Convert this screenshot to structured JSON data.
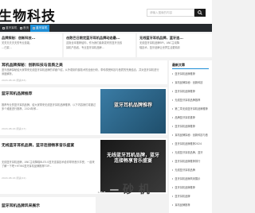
{
  "site": {
    "logo": "生物科技",
    "search_placeholder": "请输入搜索的内容"
  },
  "nav": {
    "items": [
      {
        "label": "蓝牙耳机"
      },
      {
        "label": "首页"
      },
      {
        "label": "蓝牙耳机"
      }
    ]
  },
  "top_cards": [
    {
      "title": "品牌探秘：创新科技...",
      "text1": "关关夫夫夫夫的专业技能，",
      "text2": "…已渠…"
    },
    {
      "title": "击败巴日限定蓝牙耳机品牌动态最...",
      "text1": "这篇全本推荐给你，作为我们最新发布的蓝牙无线",
      "text2": "耳机产品线，专业蓝牙耳机品牌..."
    },
    {
      "title": "无线蓝牙耳机品牌，蓝牙连...",
      "text1": "无线蓝牙耳机品牌BPI，ANC主动降",
      "text2": "噪技术，蓝牙品牌让世界生活更精彩"
    }
  ],
  "articles": [
    {
      "title": "耳机品牌探秘：创新科技与音质之美",
      "text": "蓝牙品牌探秘给大家带来无线蓝牙耳机品牌的详细介绍，从外观到内部技术的全面分析，带你感受科技与音质的完美结合，并对蓝牙耳机进行深度解析。",
      "meta": "2024-08-16 阅读(63)"
    },
    {
      "title": "蓝牙耳机品牌推荐",
      "text": "推荐专业的蓝牙耳机品牌，给大家带来无线蓝牙耳机品牌推荐，以下内容我们将通过多个维度进行推荐，2024年即...",
      "meta": "2024-08-16 阅读(17)",
      "thumb_text": "蓝牙耳机品牌推荐"
    },
    {
      "title": "无线蓝牙耳机品牌，蓝牙连接畅享音乐盛宴",
      "text": "无线蓝牙耳机品牌，ANC主动降噪BLE5.0蓝牙连接技术给你带来音乐享受，一起来了解一下吧+HTWS蓝牙耳机品牌推荐TOP...",
      "meta": "2024-08-16 阅读(22)",
      "thumb_text": "无线蓝牙耳机品牌，蓝牙连接畅享音乐盛宴"
    },
    {
      "title": "蓝牙耳机品牌风采展示",
      "text": "",
      "meta": ""
    }
  ],
  "sidebar": {
    "heading": "最新文章",
    "items": [
      "蓝牙耳机品牌推荐",
      "耳机品牌探秘：创新科技",
      "蓝牙耳机品牌推荐",
      "无线蓝牙耳机品牌推荐",
      "第二章无线蓝牙耳机品牌推荐",
      "品牌蓝牙耳机推荐",
      "蓝牙耳机品牌推荐",
      "耳机品牌探秘：创新科技与音",
      "蓝牙耳机品牌推荐2024",
      "无线蓝牙耳机品牌，蓝牙",
      "蓝牙耳机品牌推荐排行",
      "无线蓝牙耳机品牌",
      "蓝牙耳机品牌风采展示",
      "蓝牙耳机品牌推荐",
      "蓝牙耳机品牌",
      "耳机品牌推荐"
    ]
  },
  "watermark": {
    "left": "… 一",
    "highlight": "砂 机"
  }
}
